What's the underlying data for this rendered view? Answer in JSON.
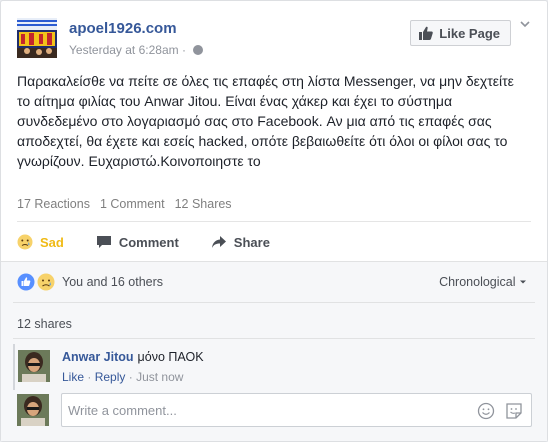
{
  "post": {
    "page_name": "apoel1926.com",
    "timestamp": "Yesterday at 6:28am",
    "meta_separator": "·",
    "like_page_label": "Like Page",
    "text": "Παρακαλείσθε να πείτε σε όλες τις επαφές στη λίστα Messenger, να μην δεχτείτε το αίτημα φιλίας του Anwar Jitou. Είναι ένας χάκερ και έχει το σύστημα συνδεδεμένο στο λογαριασμό σας στο Facebook. Αν μια από τις επαφές σας αποδεχτεί, θα έχετε και εσείς hacked, οπότε βεβαιωθείτε ότι όλοι οι φίλοι σας το γνωρίζουν. Ευχαριστώ.Κοινοποιηστε το"
  },
  "stats": {
    "reactions": "17 Reactions",
    "comments": "1 Comment",
    "shares": "12 Shares"
  },
  "actions": {
    "sad_label": "Sad",
    "comment_label": "Comment",
    "share_label": "Share"
  },
  "reactions_bar": {
    "summary": "You and 16 others",
    "order_label": "Chronological"
  },
  "shares_line": "12 shares",
  "comment": {
    "author": "Anwar Jitou",
    "text": "μόνο ΠΑΟΚ",
    "like_label": "Like",
    "reply_label": "Reply",
    "time": "Just now",
    "separator": "·"
  },
  "composer": {
    "placeholder": "Write a comment..."
  },
  "colors": {
    "link_blue": "#365899",
    "like_blue": "#5890ff",
    "sad_yellow": "#f0ba15"
  }
}
